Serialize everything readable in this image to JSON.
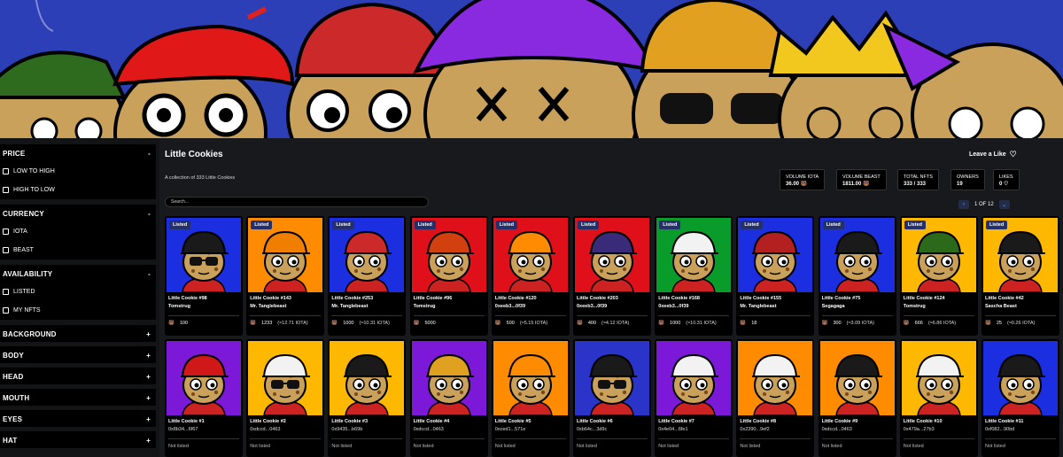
{
  "collection": {
    "title": "Little Cookies",
    "description": "A collection of 333 Little Cookies",
    "like_label": "Leave a Like"
  },
  "stats": [
    {
      "label": "VOLUME IOTA",
      "value": "36.00"
    },
    {
      "label": "VOLUME BEAST",
      "value": "1811.00"
    },
    {
      "label": "TOTAL NFTS",
      "value": "333 / 333"
    },
    {
      "label": "OWNERS",
      "value": "19"
    },
    {
      "label": "LIKES",
      "value": "0"
    }
  ],
  "search": {
    "placeholder": "Search..."
  },
  "pagination": {
    "label": "1 OF 12"
  },
  "sidebar": {
    "price": {
      "title": "PRICE",
      "options": [
        "LOW TO HIGH",
        "HIGH TO LOW"
      ]
    },
    "currency": {
      "title": "CURRENCY",
      "options": [
        "IOTA",
        "BEAST"
      ]
    },
    "availability": {
      "title": "AVAILABILITY",
      "options": [
        "LISTED",
        "MY NFTS"
      ]
    },
    "filters": [
      "BACKGROUND",
      "BODY",
      "HEAD",
      "MOUTH",
      "EYES",
      "HAT"
    ]
  },
  "colors": {
    "accent": "#24306c",
    "banner": "#2c3fb7"
  },
  "cards": [
    {
      "name": "Little Cookie #98",
      "owner": "Tomstrug",
      "price": "100",
      "iota": "",
      "listed": "Listed",
      "bg": "#1b2ee0",
      "hat": "#1a1a1a",
      "glasses": true
    },
    {
      "name": "Little Cookie #143",
      "owner": "Mr. Tanglebeast",
      "price": "1233",
      "iota": "(≈12.71 IOTA)",
      "listed": "Listed",
      "bg": "#ff8c00",
      "hat": "#f07f00",
      "glasses": false
    },
    {
      "name": "Little Cookie #253",
      "owner": "Mr. Tanglebeast",
      "price": "1000",
      "iota": "(≈10.31 IOTA)",
      "listed": "Listed",
      "bg": "#1b2ee0",
      "hat": "#cc2a2a",
      "glasses": false
    },
    {
      "name": "Little Cookie #96",
      "owner": "Tomstrug",
      "price": "5000",
      "iota": "",
      "listed": "Listed",
      "bg": "#e0101a",
      "hat": "#d24010",
      "glasses": false
    },
    {
      "name": "Little Cookie #120",
      "owner": "0xeeb3...0f39",
      "price": "500",
      "iota": "(≈5.15 IOTA)",
      "listed": "Listed",
      "bg": "#e0101a",
      "hat": "#ff8c00",
      "glasses": false
    },
    {
      "name": "Little Cookie #203",
      "owner": "0xeeb3...0f39",
      "price": "400",
      "iota": "(≈4.12 IOTA)",
      "listed": "Listed",
      "bg": "#e0101a",
      "hat": "#3a2a7a",
      "glasses": false
    },
    {
      "name": "Little Cookie #168",
      "owner": "0xeeb3...0f39",
      "price": "1000",
      "iota": "(≈10.31 IOTA)",
      "listed": "Listed",
      "bg": "#0a9c2a",
      "hat": "#f2f2f2",
      "glasses": false
    },
    {
      "name": "Little Cookie #155",
      "owner": "Mr. Tanglebeast",
      "price": "18",
      "iota": "",
      "listed": "Listed",
      "bg": "#1b2ee0",
      "hat": "#b22020",
      "glasses": false
    },
    {
      "name": "Little Cookie #75",
      "owner": "Segagaga",
      "price": "300",
      "iota": "(≈3.09 IOTA)",
      "listed": "Listed",
      "bg": "#1b2ee0",
      "hat": "#1a1a1a",
      "glasses": false
    },
    {
      "name": "Little Cookie #124",
      "owner": "Tomstrug",
      "price": "666",
      "iota": "(≈6.86 IOTA)",
      "listed": "Listed",
      "bg": "#ffb800",
      "hat": "#2a6a1a",
      "glasses": false
    },
    {
      "name": "Little Cookie #42",
      "owner": "Sascha Beast",
      "price": "25",
      "iota": "(≈0.26 IOTA)",
      "listed": "Listed",
      "bg": "#ffb800",
      "hat": "#1a1a1a",
      "glasses": false
    },
    {
      "name": "Little Cookie #1",
      "owner": "0x8b34...6f67",
      "nl": "Not listed",
      "bg": "#7c18d8",
      "hat": "#d01818",
      "glasses": false
    },
    {
      "name": "Little Cookie #2",
      "owner": "0xdccd...0463",
      "nl": "Not listed",
      "bg": "#ffb800",
      "hat": "#f2f2f2",
      "glasses": true
    },
    {
      "name": "Little Cookie #3",
      "owner": "0x9435...b69b",
      "nl": "Not listed",
      "bg": "#ffb800",
      "hat": "#1a1a1a",
      "glasses": false
    },
    {
      "name": "Little Cookie #4",
      "owner": "0xdccd...0463",
      "nl": "Not listed",
      "bg": "#7c18d8",
      "hat": "#e0a020",
      "glasses": false
    },
    {
      "name": "Little Cookie #5",
      "owner": "0xced1...571e",
      "nl": "Not listed",
      "bg": "#ff8c00",
      "hat": "#ff8c00",
      "glasses": false
    },
    {
      "name": "Little Cookie #6",
      "owner": "0xb64c...3d9c",
      "nl": "Not listed",
      "bg": "#2a34c8",
      "hat": "#1a1a1a",
      "glasses": true
    },
    {
      "name": "Little Cookie #7",
      "owner": "0x4e04...6fe1",
      "nl": "Not listed",
      "bg": "#7c18d8",
      "hat": "#f2f2f2",
      "glasses": false
    },
    {
      "name": "Little Cookie #8",
      "owner": "0x2390...9ef2",
      "nl": "Not listed",
      "bg": "#ff8c00",
      "hat": "#f2f2f2",
      "glasses": false
    },
    {
      "name": "Little Cookie #9",
      "owner": "0xdccd...0463",
      "nl": "Not listed",
      "bg": "#ff8c00",
      "hat": "#1a1a1a",
      "glasses": false
    },
    {
      "name": "Little Cookie #10",
      "owner": "0x479a...27b3",
      "nl": "Not listed",
      "bg": "#ffb800",
      "hat": "#f2f2f2",
      "glasses": false
    },
    {
      "name": "Little Cookie #11",
      "owner": "0xf082...90bd",
      "nl": "Not listed",
      "bg": "#1b2ee0",
      "hat": "#1a1a1a",
      "glasses": false
    }
  ]
}
